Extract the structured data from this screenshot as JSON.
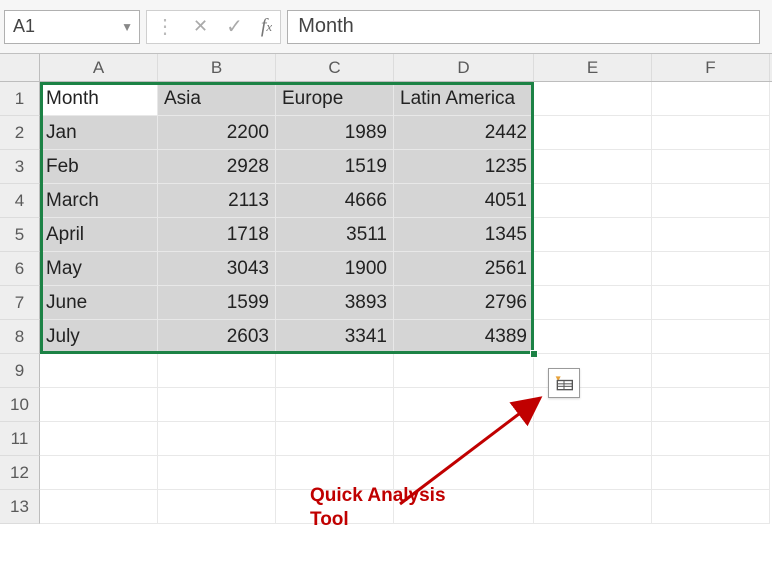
{
  "name_box": {
    "value": "A1"
  },
  "formula_bar": {
    "value": "Month"
  },
  "columns": [
    "A",
    "B",
    "C",
    "D",
    "E",
    "F"
  ],
  "row_numbers": [
    "1",
    "2",
    "3",
    "4",
    "5",
    "6",
    "7",
    "8",
    "9",
    "10",
    "11",
    "12",
    "13"
  ],
  "table": {
    "headers": {
      "A": "Month",
      "B": "Asia",
      "C": "Europe",
      "D": "Latin America"
    },
    "rows": [
      {
        "A": "Jan",
        "B": "2200",
        "C": "1989",
        "D": "2442"
      },
      {
        "A": "Feb",
        "B": "2928",
        "C": "1519",
        "D": "1235"
      },
      {
        "A": "March",
        "B": "2113",
        "C": "4666",
        "D": "4051"
      },
      {
        "A": "April",
        "B": "1718",
        "C": "3511",
        "D": "1345"
      },
      {
        "A": "May",
        "B": "3043",
        "C": "1900",
        "D": "2561"
      },
      {
        "A": "June",
        "B": "1599",
        "C": "3893",
        "D": "2796"
      },
      {
        "A": "July",
        "B": "2603",
        "C": "3341",
        "D": "4389"
      }
    ]
  },
  "annotation": {
    "line1": "Quick Analysis",
    "line2": "Tool"
  },
  "chart_data": {
    "type": "table",
    "title": "",
    "categories": [
      "Jan",
      "Feb",
      "March",
      "April",
      "May",
      "June",
      "July"
    ],
    "series": [
      {
        "name": "Asia",
        "values": [
          2200,
          2928,
          2113,
          1718,
          3043,
          1599,
          2603
        ]
      },
      {
        "name": "Europe",
        "values": [
          1989,
          1519,
          4666,
          3511,
          1900,
          3893,
          3341
        ]
      },
      {
        "name": "Latin America",
        "values": [
          2442,
          1235,
          4051,
          1345,
          2561,
          2796,
          4389
        ]
      }
    ]
  }
}
